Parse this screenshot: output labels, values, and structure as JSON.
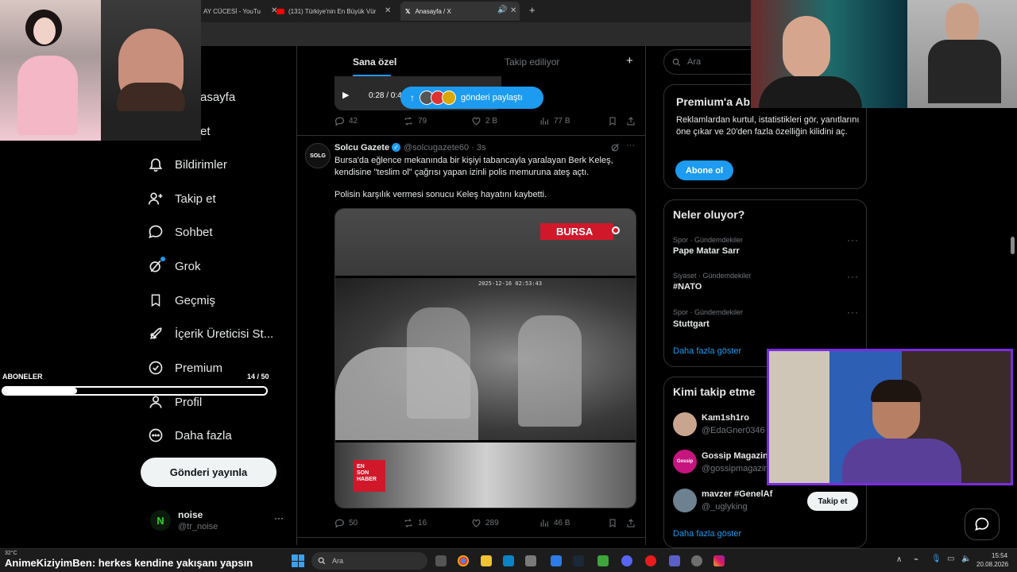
{
  "browser": {
    "tabs": [
      {
        "label": "AY CÜCESİ - YouTu",
        "active": false
      },
      {
        "label": "(131) Türkiye'nin En Büyük Vür",
        "active": false
      },
      {
        "label": "Anasayfa / X",
        "active": true
      }
    ],
    "new_tab": "+"
  },
  "nav": {
    "items": [
      {
        "label": "asayfa"
      },
      {
        "label": "et"
      },
      {
        "label": "Bildirimler"
      },
      {
        "label": "Takip et"
      },
      {
        "label": "Sohbet"
      },
      {
        "label": "Grok"
      },
      {
        "label": "Geçmiş"
      },
      {
        "label": "İçerik Üreticisi St..."
      },
      {
        "label": "Premium"
      },
      {
        "label": "Profil"
      },
      {
        "label": "Daha fazla"
      }
    ],
    "post_button": "Gönderi yayınla",
    "account": {
      "name": "noise",
      "handle": "@tr_noise",
      "more": "···"
    }
  },
  "overlay": {
    "subs_label": "ABONELER",
    "subs_count": "14 / 50",
    "subs_progress": 0.28,
    "chat_user": "AnimeKiziyimBen",
    "chat_text": ": herkes kendine yakışanı yapsın",
    "weather": "32°C"
  },
  "timeline": {
    "tabs": {
      "for_you": "Sana özel",
      "following": "Takip ediliyor",
      "plus": "+"
    },
    "prev_post": {
      "video_time": "0:28 / 0:4",
      "share_banner": "gönderi paylaştı",
      "replies": "42",
      "reposts": "79",
      "likes": "2 B",
      "views": "77 B"
    },
    "post": {
      "avatar_text": "SOLG",
      "author": "Solcu Gazete",
      "handle": "@solcugazete60 · 3s",
      "text1": "Bursa'da eğlence mekanında bir kişiyi tabancayla yaralayan Berk Keleş, kendisine \"teslim ol\" çağrısı yapan izinli polis memuruna ateş açtı.",
      "text2": "Polisin karşılık vermesi sonucu Keleş hayatını kaybetti.",
      "media_badge": "BURSA",
      "media_logo": [
        "EN",
        "SON",
        "HABER"
      ],
      "media_stamp_top": "2025-12-16 02:53:43",
      "replies": "50",
      "reposts": "16",
      "likes": "289",
      "views": "46 B"
    }
  },
  "sidebar": {
    "search_placeholder": "Ara",
    "premium": {
      "title": "Premium'a Ab",
      "desc": "Reklamlardan kurtul, istatistikleri gör, yanıtlarını öne çıkar ve 20'den fazla özelliğin kilidini aç.",
      "button": "Abone ol"
    },
    "trends": {
      "title": "Neler oluyor?",
      "items": [
        {
          "category": "Spor · Gündemdekiler",
          "name": "Pape Matar Sarr"
        },
        {
          "category": "Siyaset · Gündemdekiler",
          "name": "#NATO"
        },
        {
          "category": "Spor · Gündemdekiler",
          "name": "Stuttgart"
        }
      ],
      "more": "Daha fazla göster"
    },
    "who_to_follow": {
      "title": "Kimi takip etme",
      "items": [
        {
          "name": "Kam1sh1ro",
          "handle": "@EdaGner0346"
        },
        {
          "name": "Gossip Magazin",
          "handle": "@gossipmagazin"
        },
        {
          "name": "mavzer #GenelAf",
          "handle": "@_uglyking"
        }
      ],
      "follow_button": "Takip et",
      "more": "Daha fazla göster"
    }
  },
  "taskbar": {
    "search_placeholder": "Ara",
    "time": "15:54",
    "date": "20.08.2026"
  },
  "colors": {
    "accent": "#1d9bf0",
    "live_red": "#e0202a",
    "background": "#000000"
  }
}
